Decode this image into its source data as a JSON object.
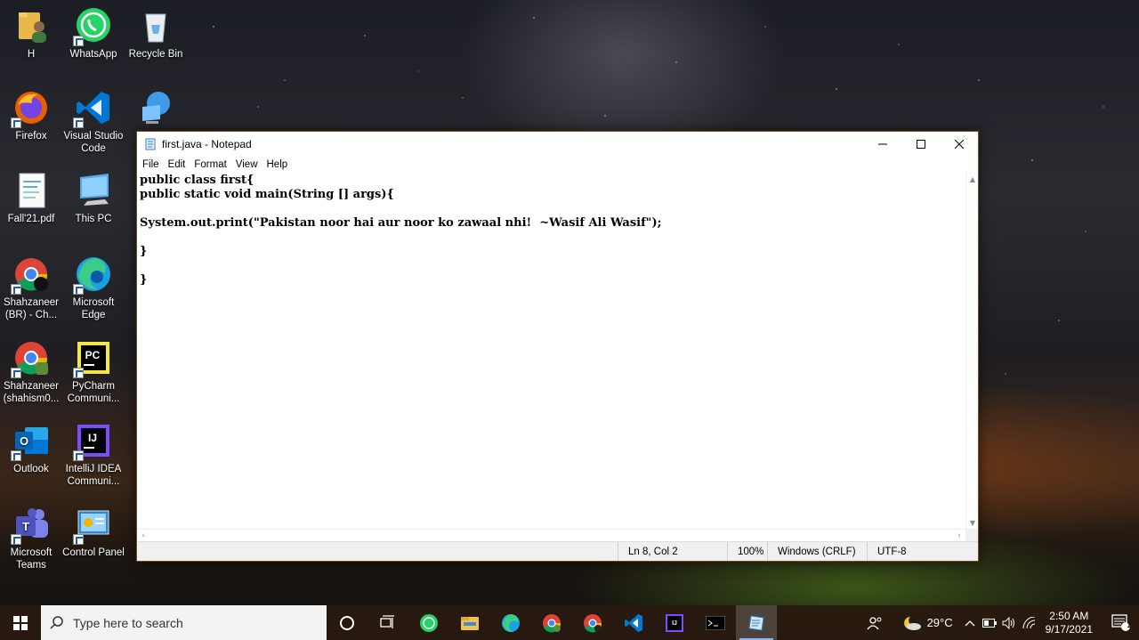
{
  "desktop": {
    "icons": [
      {
        "label": "H"
      },
      {
        "label": "WhatsApp"
      },
      {
        "label": "Recycle Bin"
      },
      {
        "label": "Firefox"
      },
      {
        "label": "Visual Studio Code"
      },
      {
        "label": ""
      },
      {
        "label": "Fall'21.pdf"
      },
      {
        "label": "This PC"
      },
      {
        "label": "Shahzaneer (BR) - Ch..."
      },
      {
        "label": "Microsoft Edge"
      },
      {
        "label": "Shahzaneer (shahism0..."
      },
      {
        "label": "PyCharm Communi..."
      },
      {
        "label": "Outlook"
      },
      {
        "label": "IntelliJ IDEA Communi..."
      },
      {
        "label": "Microsoft Teams"
      },
      {
        "label": "Control Panel"
      }
    ]
  },
  "notepad": {
    "title": "first.java - Notepad",
    "menu": [
      "File",
      "Edit",
      "Format",
      "View",
      "Help"
    ],
    "content": "public class first{\npublic static void main(String [] args){\n\nSystem.out.print(\"Pakistan noor hai aur noor ko zawaal nhi!  ~Wasif Ali Wasif\");\n\n}\n\n}",
    "status": {
      "position": "Ln 8, Col 2",
      "zoom": "100%",
      "line_ending": "Windows (CRLF)",
      "encoding": "UTF-8"
    }
  },
  "taskbar": {
    "search_placeholder": "Type here to search",
    "temperature": "29°C",
    "time": "2:50 AM",
    "date": "9/17/2021",
    "notification_count": "1"
  }
}
